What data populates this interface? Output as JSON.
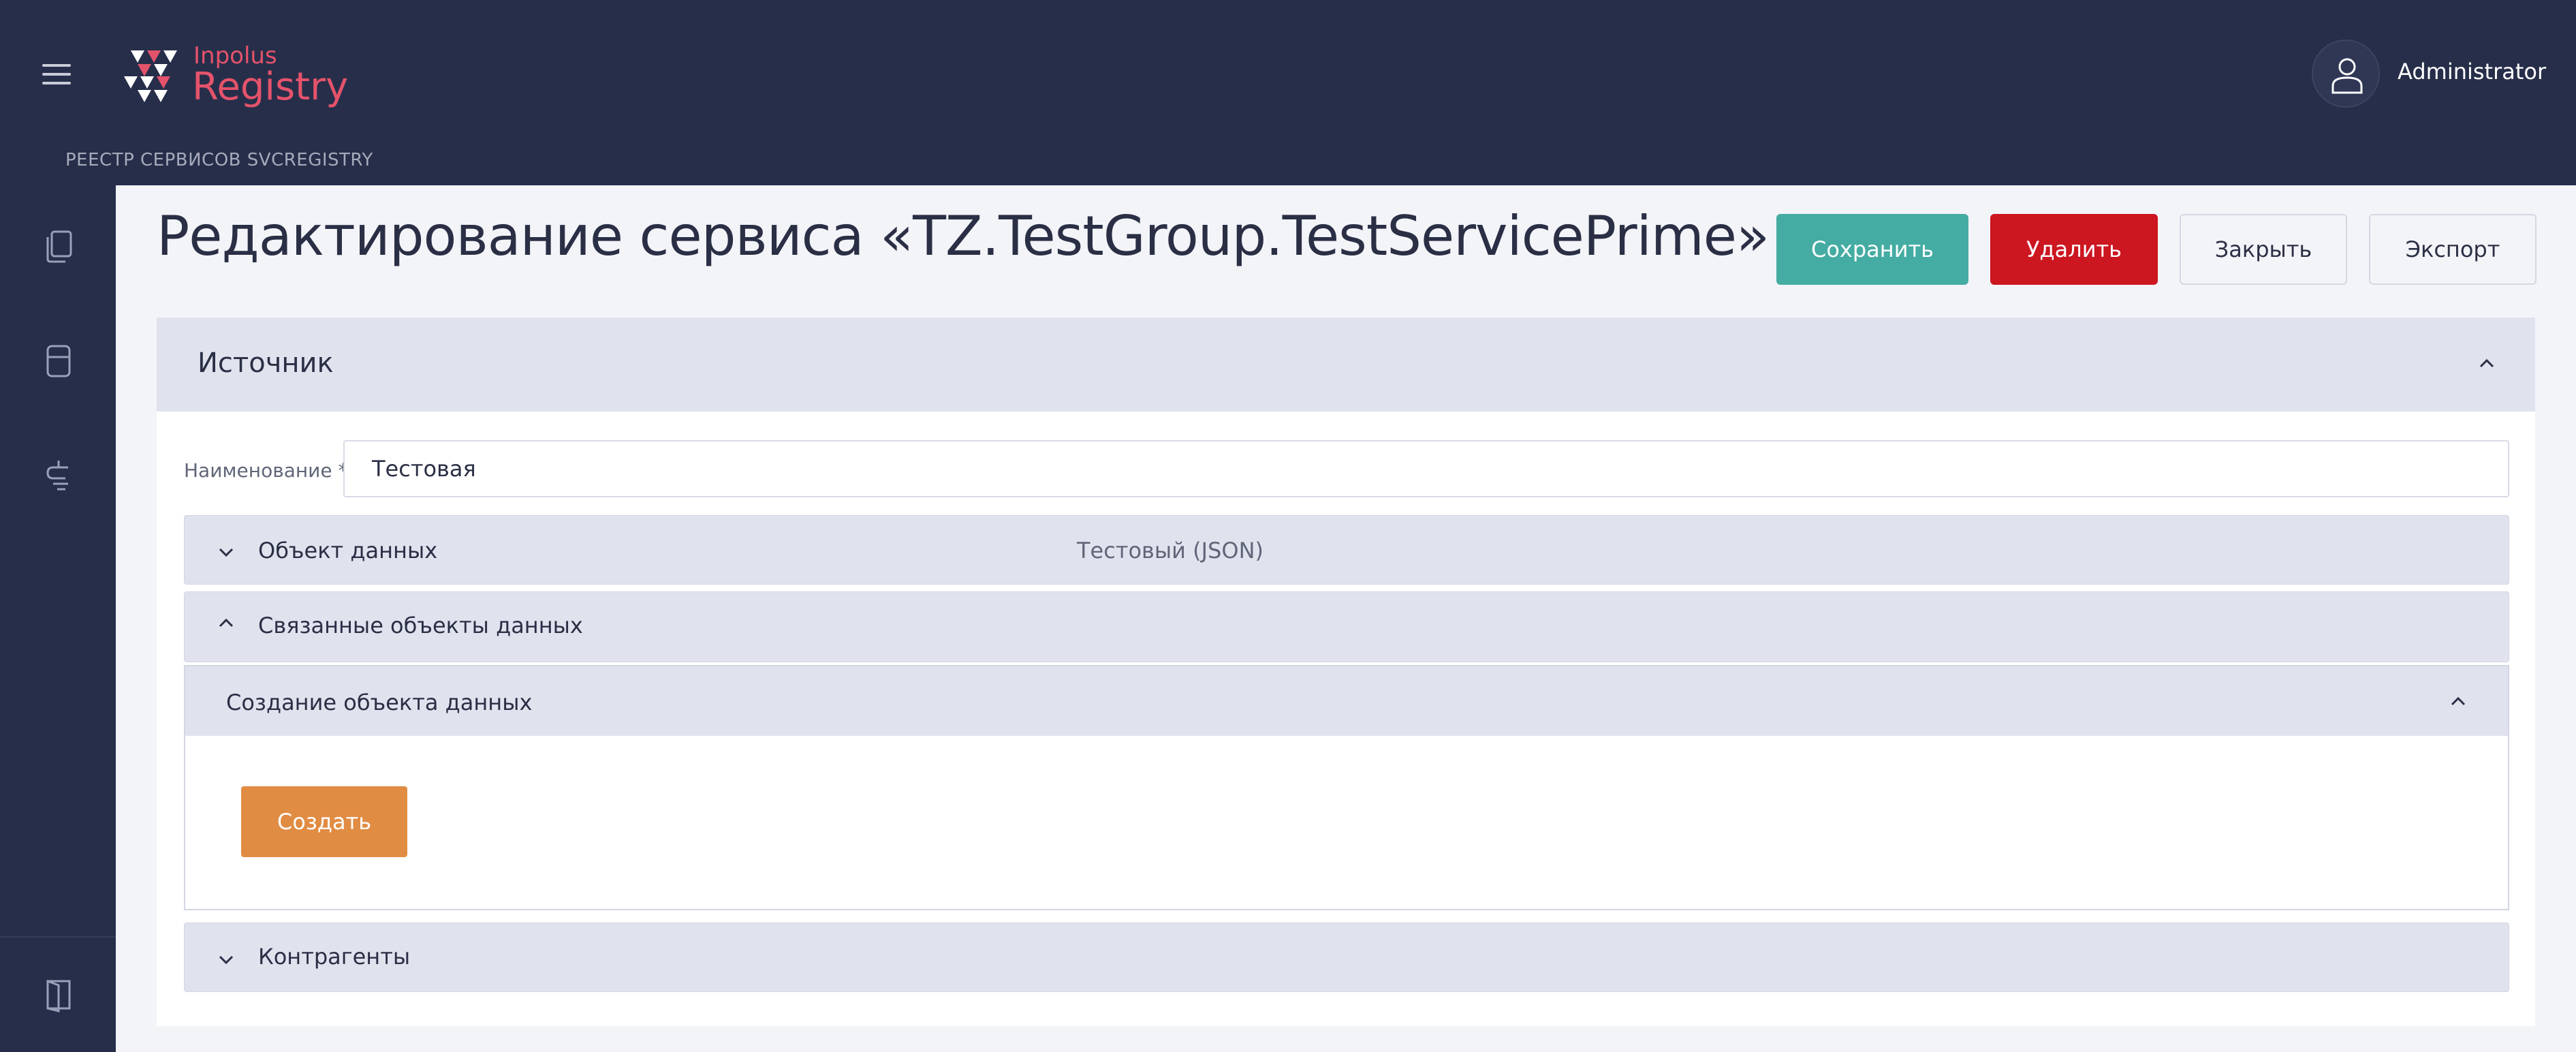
{
  "app": {
    "logo_small": "Inpolus",
    "logo_main": "Registry",
    "breadcrumb": "РЕЕСТР СЕРВИСОВ SVCREGISTRY",
    "user": "Administrator"
  },
  "sidebar": {
    "icons": [
      "documents-icon",
      "database-icon",
      "services-icon",
      "exit-icon"
    ]
  },
  "page": {
    "title": "Редактирование сервиса «TZ.TestGroup.TestServicePrime»",
    "actions": {
      "save": "Сохранить",
      "delete": "Удалить",
      "close": "Закрыть",
      "export": "Экспорт"
    }
  },
  "source": {
    "title": "Источник",
    "name_label": "Наименование *",
    "name_value": "Тестовая",
    "data_object": {
      "label": "Объект данных",
      "value": "Тестовый (JSON)"
    },
    "related_objects": {
      "label": "Связанные объекты данных"
    },
    "create_object": {
      "title": "Создание объекта данных",
      "button": "Создать"
    },
    "contractors": {
      "label": "Контрагенты"
    }
  },
  "colors": {
    "header_bg": "#272e4a",
    "accent_logo": "#e4536b",
    "save": "#45aca3",
    "delete": "#cc1620",
    "create": "#e18c43"
  }
}
